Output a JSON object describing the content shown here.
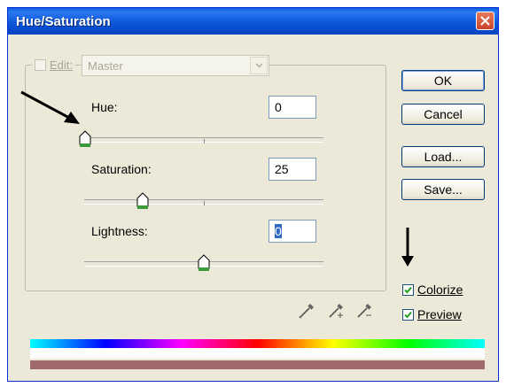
{
  "window": {
    "title": "Hue/Saturation"
  },
  "edit": {
    "label": "Edit:",
    "value": "Master"
  },
  "hue": {
    "label": "Hue:",
    "value": "0",
    "fraction": 0.0
  },
  "saturation": {
    "label": "Saturation:",
    "value": "25",
    "fraction": 0.25
  },
  "lightness": {
    "label": "Lightness:",
    "value": "0",
    "fraction": 0.5
  },
  "buttons": {
    "ok": "OK",
    "cancel": "Cancel",
    "load": "Load...",
    "save": "Save..."
  },
  "checkboxes": {
    "colorize": {
      "label": "Colorize",
      "checked": true
    },
    "preview": {
      "label": "Preview",
      "checked": true
    }
  },
  "colors": {
    "titlebar": "#0a54d8",
    "result_bar": "#a06a6a",
    "thumb_green": "#3c9a3c"
  },
  "icons": [
    "close-icon",
    "eyedropper-icon",
    "eyedropper-plus-icon",
    "eyedropper-minus-icon",
    "chevron-down-icon"
  ]
}
